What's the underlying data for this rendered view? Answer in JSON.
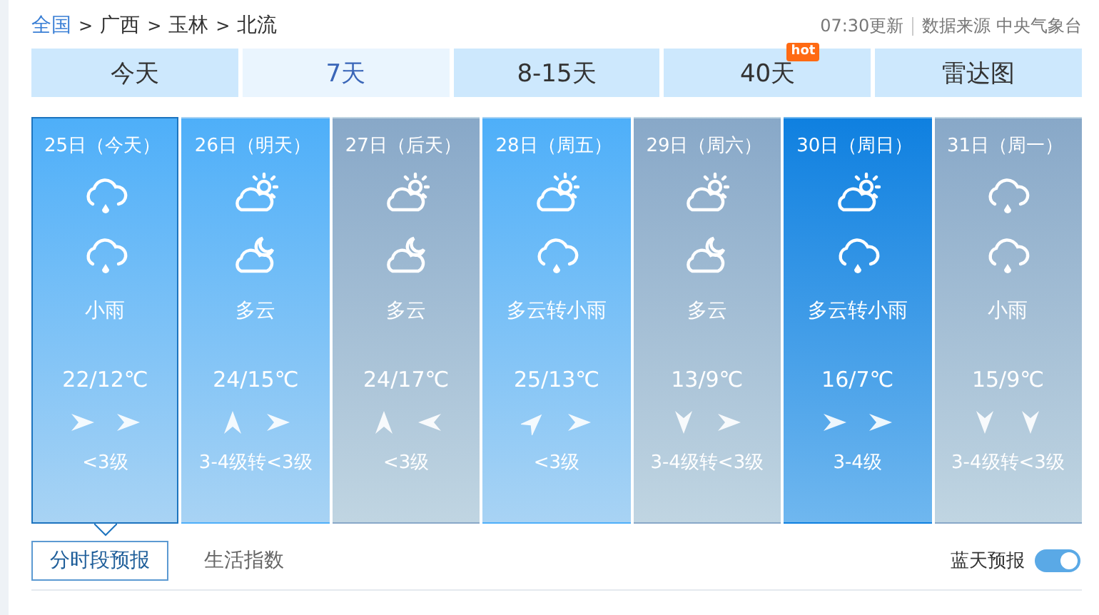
{
  "breadcrumb": [
    {
      "label": "全国",
      "link": true
    },
    {
      "label": "广西",
      "link": false
    },
    {
      "label": "玉林",
      "link": false
    },
    {
      "label": "北流",
      "link": false
    }
  ],
  "separator": ">",
  "update_time": "07:30更新",
  "source": "数据来源 中央气象台",
  "tabs": [
    {
      "label": "今天",
      "selected": false
    },
    {
      "label": "7天",
      "selected": true
    },
    {
      "label": "8-15天",
      "selected": false
    },
    {
      "label": "40天",
      "selected": false,
      "badge": "hot"
    },
    {
      "label": "雷达图",
      "selected": false
    }
  ],
  "days": [
    {
      "date": "25日（今天）",
      "kind": "blue",
      "selected": true,
      "icons": [
        {
          "kind": "rain"
        },
        {
          "kind": "rain"
        }
      ],
      "weather": "小雨",
      "temp": "22/12℃",
      "wind": [
        {
          "kind": "east"
        },
        {
          "kind": "east"
        }
      ],
      "wind_level": "<3级"
    },
    {
      "date": "26日（明天）",
      "kind": "blue",
      "selected": false,
      "icons": [
        {
          "kind": "sun-cloud"
        },
        {
          "kind": "moon-cloud"
        }
      ],
      "weather": "多云",
      "temp": "24/15℃",
      "wind": [
        {
          "kind": "north"
        },
        {
          "kind": "east"
        }
      ],
      "wind_level": "3-4级转<3级"
    },
    {
      "date": "27日（后天）",
      "kind": "grey",
      "selected": false,
      "icons": [
        {
          "kind": "sun-cloud"
        },
        {
          "kind": "moon-cloud"
        }
      ],
      "weather": "多云",
      "temp": "24/17℃",
      "wind": [
        {
          "kind": "north"
        },
        {
          "kind": "west"
        }
      ],
      "wind_level": "<3级"
    },
    {
      "date": "28日（周五）",
      "kind": "blue",
      "selected": false,
      "icons": [
        {
          "kind": "sun-cloud"
        },
        {
          "kind": "rain"
        }
      ],
      "weather": "多云转小雨",
      "temp": "25/13℃",
      "wind": [
        {
          "kind": "northeast"
        },
        {
          "kind": "east"
        }
      ],
      "wind_level": "<3级"
    },
    {
      "date": "29日（周六）",
      "kind": "grey",
      "selected": false,
      "icons": [
        {
          "kind": "sun-cloud"
        },
        {
          "kind": "moon-cloud"
        }
      ],
      "weather": "多云",
      "temp": "13/9℃",
      "wind": [
        {
          "kind": "south"
        },
        {
          "kind": "east"
        }
      ],
      "wind_level": "3-4级转<3级"
    },
    {
      "date": "30日（周日）",
      "kind": "deep",
      "selected": false,
      "icons": [
        {
          "kind": "sun-cloud"
        },
        {
          "kind": "rain"
        }
      ],
      "weather": "多云转小雨",
      "temp": "16/7℃",
      "wind": [
        {
          "kind": "east"
        },
        {
          "kind": "east"
        }
      ],
      "wind_level": "3-4级"
    },
    {
      "date": "31日（周一）",
      "kind": "grey",
      "selected": false,
      "icons": [
        {
          "kind": "rain"
        },
        {
          "kind": "rain"
        }
      ],
      "weather": "小雨",
      "temp": "15/9℃",
      "wind": [
        {
          "kind": "south"
        },
        {
          "kind": "south"
        }
      ],
      "wind_level": "3-4级转<3级"
    }
  ],
  "subtabs": [
    {
      "label": "分时段预报",
      "selected": true
    },
    {
      "label": "生活指数",
      "selected": false
    }
  ],
  "toggle": {
    "label": "蓝天预报",
    "on": true
  }
}
